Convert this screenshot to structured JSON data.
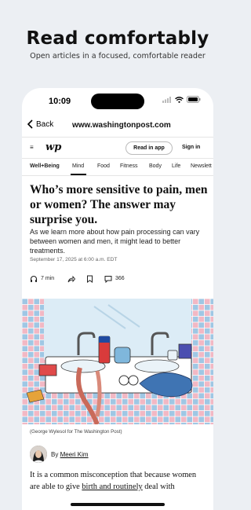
{
  "promo": {
    "title": "Read comfortably",
    "subtitle": "Open articles in a focused, comfortable reader"
  },
  "status": {
    "time": "10:09"
  },
  "browser": {
    "back_label": "Back",
    "url": "www.washingtonpost.com"
  },
  "site": {
    "logo": "wp",
    "read_in_app": "Read in app",
    "sign_in": "Sign in"
  },
  "nav": {
    "items": [
      "Well+Being",
      "Mind",
      "Food",
      "Fitness",
      "Body",
      "Life",
      "Newslett"
    ],
    "active": "Mind"
  },
  "article": {
    "headline": "Who’s more sensitive to pain, men or women? The answer may surprise you.",
    "dek": "As we learn more about how pain processing can vary between women and men, it might lead to better treatments.",
    "date": "September 17, 2025 at 6:00 a.m. EDT",
    "read_time": "7 min",
    "comments": "366",
    "image_credit": "(George Wylesol for The Washington Post)",
    "by_prefix": "By",
    "author": "Meeri Kim",
    "body_part1": "It is a common misconception that because women are able to give ",
    "body_link": "birth and routinely",
    "body_part2": " deal with"
  },
  "colors": {
    "background": "#eceff3",
    "tile_pink": "#f2b8c4",
    "tile_blue": "#9fc7e4",
    "wall": "#dcecf6"
  }
}
